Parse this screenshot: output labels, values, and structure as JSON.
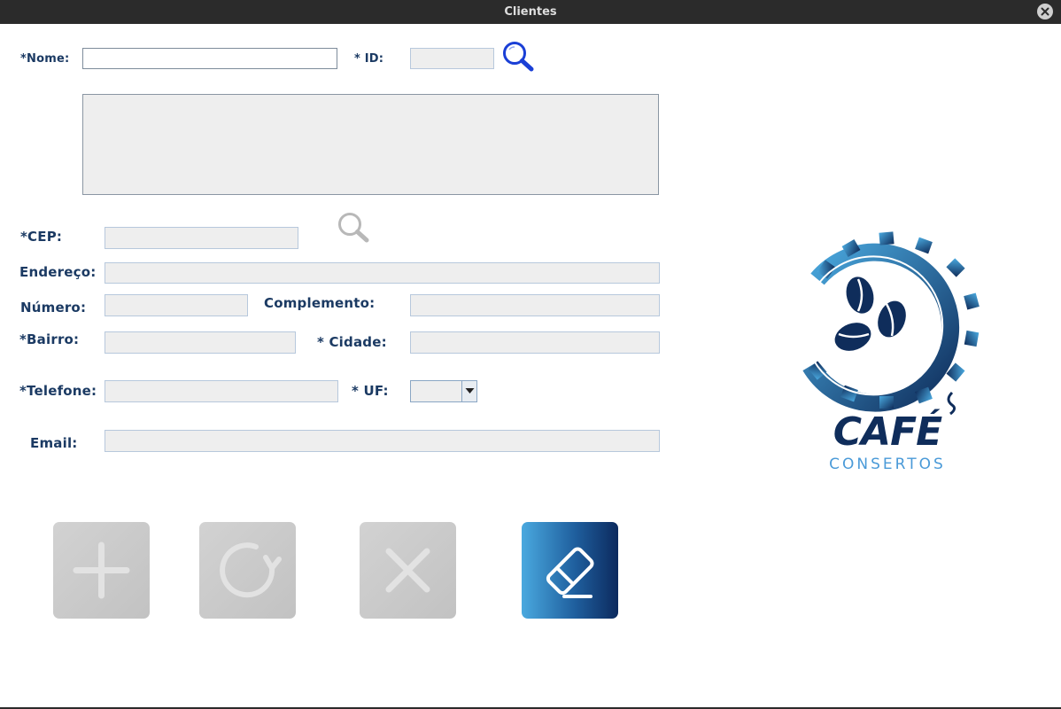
{
  "window": {
    "title": "Clientes"
  },
  "form": {
    "nome_label": "*Nome:",
    "nome_value": "",
    "id_label": "* ID:",
    "id_value": "",
    "results_value": "",
    "cep_label": "*CEP:",
    "cep_value": "",
    "endereco_label": "Endereço:",
    "endereco_value": "",
    "numero_label": "Número:",
    "numero_value": "",
    "complemento_label": "Complemento:",
    "complemento_value": "",
    "bairro_label": "*Bairro:",
    "bairro_value": "",
    "cidade_label": "* Cidade:",
    "cidade_value": "",
    "telefone_label": "*Telefone:",
    "telefone_value": "",
    "uf_label": "* UF:",
    "uf_selected": "",
    "email_label": "Email:",
    "email_value": ""
  },
  "actions": [
    {
      "name": "add",
      "icon": "plus-icon",
      "enabled": false
    },
    {
      "name": "update",
      "icon": "refresh-icon",
      "enabled": false
    },
    {
      "name": "delete",
      "icon": "close-icon",
      "enabled": false
    },
    {
      "name": "clear",
      "icon": "eraser-icon",
      "enabled": true
    }
  ],
  "logo": {
    "main": "CAFÉ",
    "sub": "CONSERTOS"
  },
  "colors": {
    "label": "#1b3a63",
    "search_active": "#1a3fd6",
    "search_disabled": "#b8b8b8",
    "brand_dark": "#0f2d5b",
    "brand_light": "#4a9ad8"
  }
}
